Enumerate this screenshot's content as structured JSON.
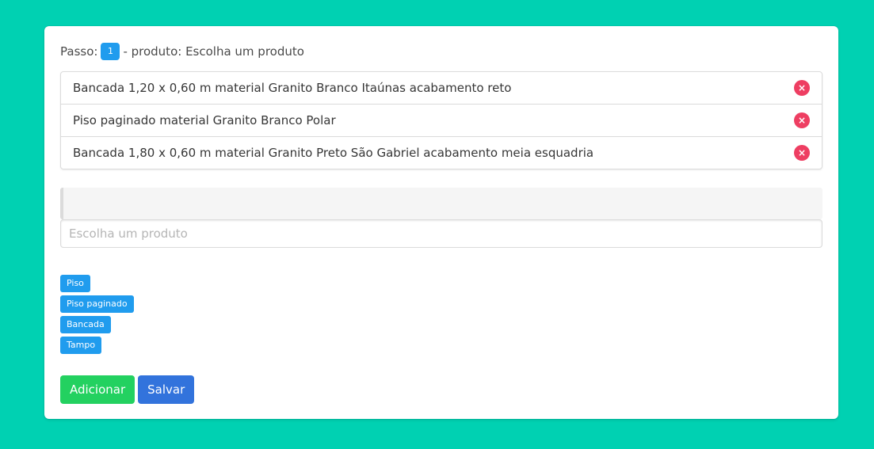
{
  "step": {
    "prefix": "Passo:",
    "number": "1",
    "suffix": "- produto: Escolha um produto"
  },
  "products": [
    {
      "label": "Bancada 1,20 x 0,60 m material Granito Branco Itaúnas acabamento reto"
    },
    {
      "label": "Piso paginado material Granito Branco Polar"
    },
    {
      "label": "Bancada 1,80 x 0,60 m material Granito Preto São Gabriel acabamento meia esquadria"
    }
  ],
  "remove_icon": "×",
  "search": {
    "placeholder": "Escolha um produto",
    "value": ""
  },
  "tags": [
    "Piso",
    "Piso paginado",
    "Bancada",
    "Tampo"
  ],
  "actions": {
    "add_label": "Adicionar",
    "save_label": "Salvar"
  },
  "colors": {
    "background": "#00d1b2",
    "info": "#209cee",
    "danger": "#ee3e62",
    "success": "#23d160",
    "primary": "#3273dc"
  }
}
